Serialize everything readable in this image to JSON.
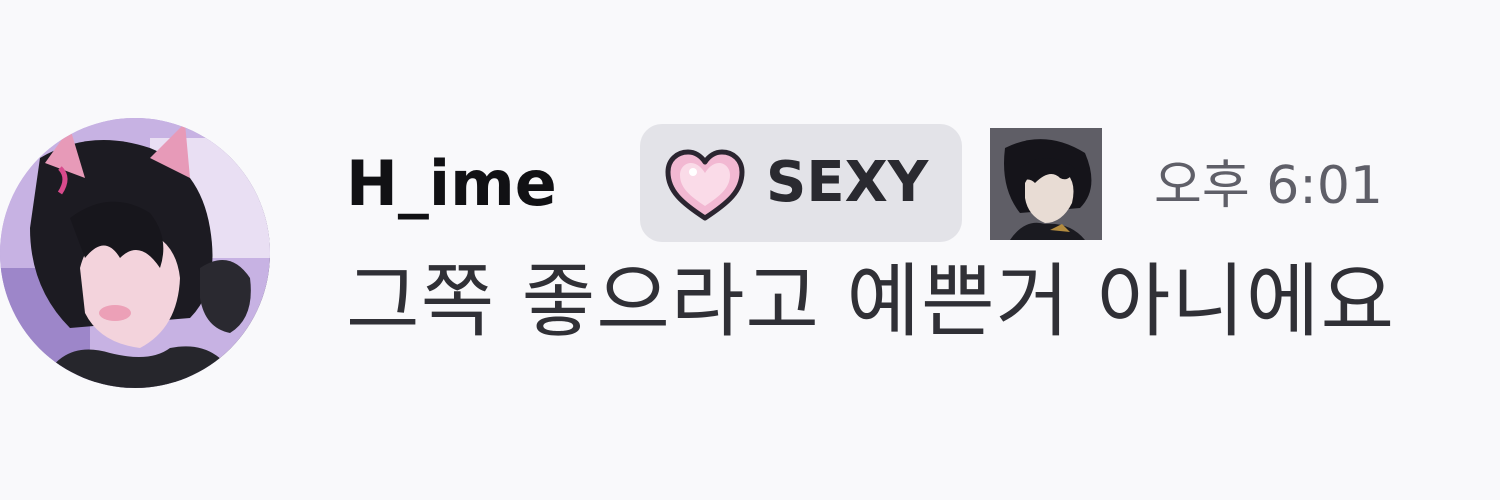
{
  "message": {
    "author": {
      "username": "H_ime",
      "role_badge": {
        "label": "SEXY",
        "icon": "pink-heart-icon"
      }
    },
    "timestamp": "오후 6:01",
    "content": "그쪽 좋으라고 예쁜거 아니에요"
  },
  "colors": {
    "background": "#f9f9fb",
    "username": "#111114",
    "badge_background": "#e3e3e8",
    "heart": "#f2b8d2",
    "timestamp": "#5f5f68",
    "content": "#303036"
  }
}
